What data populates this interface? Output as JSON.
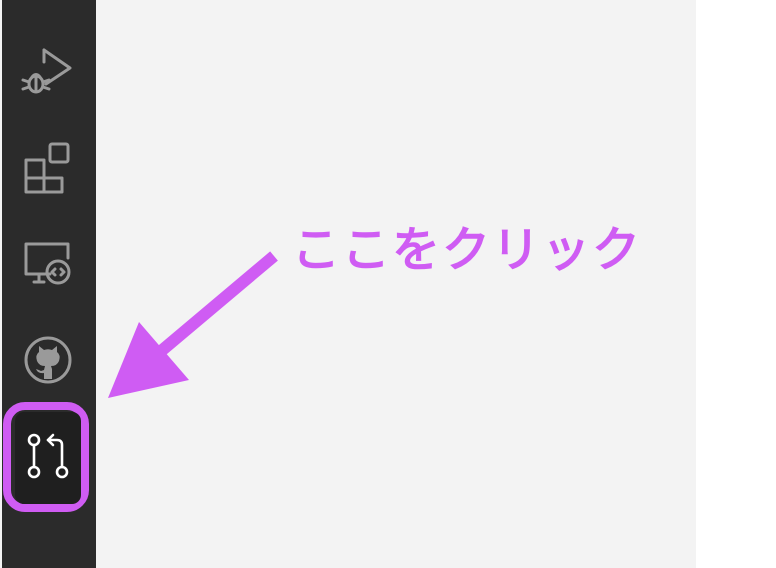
{
  "colors": {
    "accent": "#cf5cf3",
    "activity_bar": "#2b2b2b",
    "editor_bg": "#f3f3f3"
  },
  "activity_bar": {
    "items": [
      {
        "name": "run-and-debug",
        "icon": "debug-play-icon"
      },
      {
        "name": "extensions",
        "icon": "extensions-icon"
      },
      {
        "name": "remote-explorer",
        "icon": "remote-explorer-icon"
      },
      {
        "name": "github",
        "icon": "github-icon"
      },
      {
        "name": "source-control",
        "icon": "pull-request-icon",
        "highlighted": true
      }
    ]
  },
  "annotation": {
    "text": "ここをクリック"
  }
}
